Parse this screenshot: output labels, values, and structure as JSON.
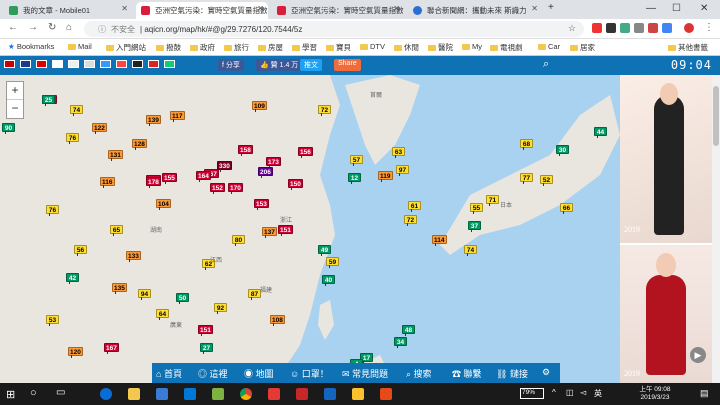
{
  "browser": {
    "tabs": [
      {
        "title": "我的文章 - Mobile01",
        "color": "#2e9c5b",
        "active": false
      },
      {
        "title": "亞洲空氣污染：實時空氣質量指數",
        "color": "#d81e3a",
        "active": true
      },
      {
        "title": "亞洲空氣污染：實時空氣質量指數",
        "color": "#d81e3a",
        "active": false
      },
      {
        "title": "聯合新聞網：攜動未來 斯識力",
        "color": "#2a6fd6",
        "active": false
      }
    ],
    "new_tab": "+",
    "security_label": "不安全",
    "url": "aqicn.org/map/hk/#@g/29.7276/120.7544/5z",
    "bookmarks": [
      "Bookmarks",
      "Mail",
      "入門網站",
      "撥鼓",
      "政府",
      "旅行",
      "房屋",
      "學習",
      "寶貝",
      "DTV",
      "休閒",
      "醫院",
      "My",
      "電視劇",
      "Car",
      "居家",
      "其他書籤"
    ]
  },
  "site": {
    "share_label": "分享",
    "like_label": "贊 1.4 万",
    "tweet_label": "推文",
    "more_label": "Share",
    "clock": "09:04",
    "nav": [
      "首頁",
      "這裡",
      "地圖",
      "口罩！",
      "常見問題",
      "搜索",
      "聯繫",
      "鏈接"
    ]
  },
  "map": {
    "legend_colors": {
      "good": "#009966",
      "moderate": "#ffde33",
      "usg": "#ff9933",
      "unhealthy": "#cc0033",
      "very_unhealthy": "#660099"
    },
    "markers": [
      {
        "v": "153",
        "c": "#cc0033"
      },
      {
        "v": "74",
        "c": "#ffde33"
      },
      {
        "v": "76",
        "c": "#ffde33"
      },
      {
        "v": "90",
        "c": "#009966"
      },
      {
        "v": "122",
        "c": "#ff9933"
      },
      {
        "v": "117",
        "c": "#ff9933"
      },
      {
        "v": "139",
        "c": "#ff9933"
      },
      {
        "v": "109",
        "c": "#ff9933"
      },
      {
        "v": "72",
        "c": "#ffde33"
      },
      {
        "v": "131",
        "c": "#ff9933"
      },
      {
        "v": "128",
        "c": "#ff9933"
      },
      {
        "v": "158",
        "c": "#cc0033"
      },
      {
        "v": "173",
        "c": "#cc0033"
      },
      {
        "v": "156",
        "c": "#cc0033"
      },
      {
        "v": "167",
        "c": "#cc0033"
      },
      {
        "v": "185",
        "c": "#cc0033"
      },
      {
        "v": "330",
        "c": "#7e0023"
      },
      {
        "v": "206",
        "c": "#660099"
      },
      {
        "v": "164",
        "c": "#cc0033"
      },
      {
        "v": "152",
        "c": "#cc0033"
      },
      {
        "v": "170",
        "c": "#cc0033"
      },
      {
        "v": "178",
        "c": "#cc0033"
      },
      {
        "v": "155",
        "c": "#cc0033"
      },
      {
        "v": "153",
        "c": "#cc0033"
      },
      {
        "v": "137",
        "c": "#ff9933"
      },
      {
        "v": "151",
        "c": "#cc0033"
      },
      {
        "v": "104",
        "c": "#ff9933"
      },
      {
        "v": "76",
        "c": "#ffde33"
      },
      {
        "v": "65",
        "c": "#ffde33"
      },
      {
        "v": "42",
        "c": "#009966"
      },
      {
        "v": "53",
        "c": "#ffde33"
      },
      {
        "v": "57",
        "c": "#ffde33"
      },
      {
        "v": "63",
        "c": "#ffde33"
      },
      {
        "v": "97",
        "c": "#ffde33"
      },
      {
        "v": "119",
        "c": "#ff9933"
      },
      {
        "v": "72",
        "c": "#ffde33"
      },
      {
        "v": "61",
        "c": "#ffde33"
      },
      {
        "v": "114",
        "c": "#ff9933"
      },
      {
        "v": "55",
        "c": "#ffde33"
      },
      {
        "v": "77",
        "c": "#ffde33"
      },
      {
        "v": "66",
        "c": "#ffde33"
      },
      {
        "v": "74",
        "c": "#ffde33"
      },
      {
        "v": "50",
        "c": "#009966"
      },
      {
        "v": "48",
        "c": "#009966"
      },
      {
        "v": "34",
        "c": "#009966"
      },
      {
        "v": "17",
        "c": "#009966"
      },
      {
        "v": "4",
        "c": "#009966"
      },
      {
        "v": "40",
        "c": "#009966"
      },
      {
        "v": "27",
        "c": "#009966"
      },
      {
        "v": "107",
        "c": "#ff9933"
      },
      {
        "v": "151",
        "c": "#cc0033"
      },
      {
        "v": "167",
        "c": "#cc0033"
      },
      {
        "v": "30",
        "c": "#009966"
      },
      {
        "v": "68",
        "c": "#ffde33"
      },
      {
        "v": "116",
        "c": "#ff9933"
      },
      {
        "v": "150",
        "c": "#cc0033"
      },
      {
        "v": "40",
        "c": "#009966"
      },
      {
        "v": "108",
        "c": "#ff9933"
      },
      {
        "v": "12",
        "c": "#009966"
      },
      {
        "v": "37",
        "c": "#009966"
      },
      {
        "v": "71",
        "c": "#ffde33"
      },
      {
        "v": "56",
        "c": "#ffde33"
      },
      {
        "v": "62",
        "c": "#ffde33"
      },
      {
        "v": "92",
        "c": "#ffde33"
      },
      {
        "v": "80",
        "c": "#ffde33"
      },
      {
        "v": "133",
        "c": "#ff9933"
      },
      {
        "v": "44",
        "c": "#009966"
      },
      {
        "v": "59",
        "c": "#ffde33"
      },
      {
        "v": "94",
        "c": "#ffde33"
      },
      {
        "v": "135",
        "c": "#ff9933"
      },
      {
        "v": "87",
        "c": "#ffde33"
      },
      {
        "v": "64",
        "c": "#ffde33"
      },
      {
        "v": "120",
        "c": "#ff9933"
      },
      {
        "v": "52",
        "c": "#ffde33"
      },
      {
        "v": "49",
        "c": "#009966"
      },
      {
        "v": "25",
        "c": "#009966"
      }
    ],
    "labels": [
      "湖南",
      "江西",
      "浙江",
      "福建",
      "廣東",
      "首爾",
      "日本"
    ]
  },
  "ad": {
    "year1": "2019",
    "year2": "2019"
  },
  "taskbar": {
    "battery": "79%",
    "time_label": "上午 09:08",
    "date": "2019/3/23"
  }
}
